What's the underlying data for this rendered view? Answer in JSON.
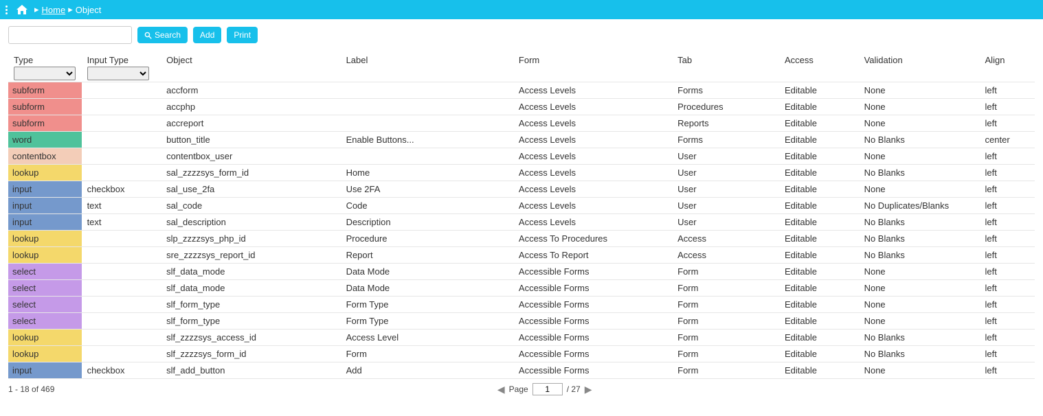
{
  "breadcrumb": {
    "home": "Home",
    "current": "Object"
  },
  "toolbar": {
    "search": "Search",
    "add": "Add",
    "print": "Print"
  },
  "columns": {
    "type": "Type",
    "input_type": "Input Type",
    "object": "Object",
    "label": "Label",
    "form": "Form",
    "tab": "Tab",
    "access": "Access",
    "validation": "Validation",
    "align": "Align"
  },
  "rows": [
    {
      "type": "subform",
      "inputType": "",
      "object": "accform",
      "label": "",
      "form": "Access Levels",
      "tab": "Forms",
      "access": "Editable",
      "validation": "None",
      "align": "left"
    },
    {
      "type": "subform",
      "inputType": "",
      "object": "accphp",
      "label": "",
      "form": "Access Levels",
      "tab": "Procedures",
      "access": "Editable",
      "validation": "None",
      "align": "left"
    },
    {
      "type": "subform",
      "inputType": "",
      "object": "accreport",
      "label": "",
      "form": "Access Levels",
      "tab": "Reports",
      "access": "Editable",
      "validation": "None",
      "align": "left"
    },
    {
      "type": "word",
      "inputType": "",
      "object": "button_title",
      "label": "Enable Buttons...",
      "form": "Access Levels",
      "tab": "Forms",
      "access": "Editable",
      "validation": "No Blanks",
      "align": "center"
    },
    {
      "type": "contentbox",
      "inputType": "",
      "object": "contentbox_user",
      "label": "",
      "form": "Access Levels",
      "tab": "User",
      "access": "Editable",
      "validation": "None",
      "align": "left"
    },
    {
      "type": "lookup",
      "inputType": "",
      "object": "sal_zzzzsys_form_id",
      "label": "Home",
      "form": "Access Levels",
      "tab": "User",
      "access": "Editable",
      "validation": "No Blanks",
      "align": "left"
    },
    {
      "type": "input",
      "inputType": "checkbox",
      "object": "sal_use_2fa",
      "label": "Use 2FA",
      "form": "Access Levels",
      "tab": "User",
      "access": "Editable",
      "validation": "None",
      "align": "left"
    },
    {
      "type": "input",
      "inputType": "text",
      "object": "sal_code",
      "label": "Code",
      "form": "Access Levels",
      "tab": "User",
      "access": "Editable",
      "validation": "No Duplicates/Blanks",
      "align": "left"
    },
    {
      "type": "input",
      "inputType": "text",
      "object": "sal_description",
      "label": "Description",
      "form": "Access Levels",
      "tab": "User",
      "access": "Editable",
      "validation": "No Blanks",
      "align": "left"
    },
    {
      "type": "lookup",
      "inputType": "",
      "object": "slp_zzzzsys_php_id",
      "label": "Procedure",
      "form": "Access To Procedures",
      "tab": "Access",
      "access": "Editable",
      "validation": "No Blanks",
      "align": "left"
    },
    {
      "type": "lookup",
      "inputType": "",
      "object": "sre_zzzzsys_report_id",
      "label": "Report",
      "form": "Access To Report",
      "tab": "Access",
      "access": "Editable",
      "validation": "No Blanks",
      "align": "left"
    },
    {
      "type": "select",
      "inputType": "",
      "object": "slf_data_mode",
      "label": "Data Mode",
      "form": "Accessible Forms",
      "tab": "Form",
      "access": "Editable",
      "validation": "None",
      "align": "left"
    },
    {
      "type": "select",
      "inputType": "",
      "object": "slf_data_mode",
      "label": "Data Mode",
      "form": "Accessible Forms",
      "tab": "Form",
      "access": "Editable",
      "validation": "None",
      "align": "left"
    },
    {
      "type": "select",
      "inputType": "",
      "object": "slf_form_type",
      "label": "Form Type",
      "form": "Accessible Forms",
      "tab": "Form",
      "access": "Editable",
      "validation": "None",
      "align": "left"
    },
    {
      "type": "select",
      "inputType": "",
      "object": "slf_form_type",
      "label": "Form Type",
      "form": "Accessible Forms",
      "tab": "Form",
      "access": "Editable",
      "validation": "None",
      "align": "left"
    },
    {
      "type": "lookup",
      "inputType": "",
      "object": "slf_zzzzsys_access_id",
      "label": "Access Level",
      "form": "Accessible Forms",
      "tab": "Form",
      "access": "Editable",
      "validation": "No Blanks",
      "align": "left"
    },
    {
      "type": "lookup",
      "inputType": "",
      "object": "slf_zzzzsys_form_id",
      "label": "Form",
      "form": "Accessible Forms",
      "tab": "Form",
      "access": "Editable",
      "validation": "No Blanks",
      "align": "left"
    },
    {
      "type": "input",
      "inputType": "checkbox",
      "object": "slf_add_button",
      "label": "Add",
      "form": "Accessible Forms",
      "tab": "Form",
      "access": "Editable",
      "validation": "None",
      "align": "left"
    }
  ],
  "footer": {
    "range": "1 - 18 of 469",
    "page_label": "Page",
    "page_current": "1",
    "page_total": "/ 27"
  }
}
